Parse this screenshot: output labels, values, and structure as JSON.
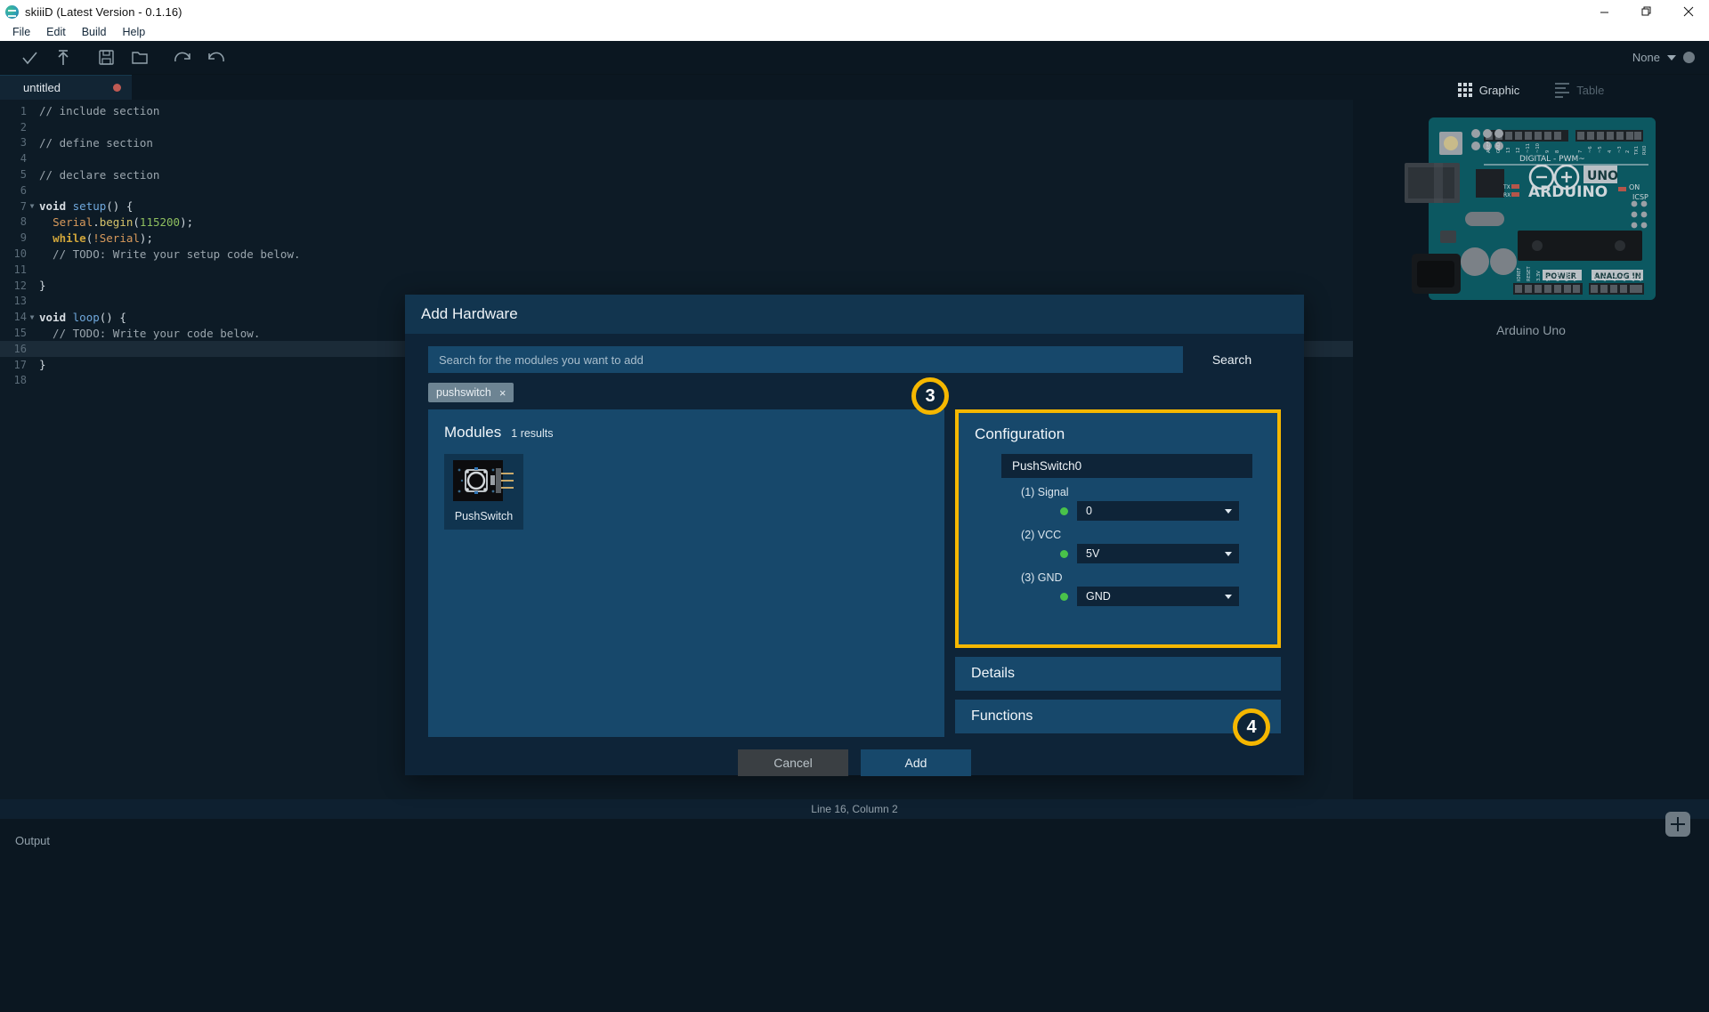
{
  "window": {
    "title": "skiiiD (Latest Version - 0.1.16)",
    "minimize_label": "minimize",
    "maximize_label": "maximize",
    "close_label": "close"
  },
  "menubar": {
    "items": [
      "File",
      "Edit",
      "Build",
      "Help"
    ]
  },
  "toolbar": {
    "icons": [
      "check-icon",
      "upload-icon",
      "save-icon",
      "open-folder-icon",
      "redo-icon",
      "undo-icon"
    ],
    "board_selector_value": "None"
  },
  "editor": {
    "tab": {
      "label": "untitled",
      "dirty": true
    },
    "current_line_number": 16,
    "lines": [
      {
        "n": 1,
        "tokens": [
          {
            "t": "// include section",
            "c": "c-comment"
          }
        ]
      },
      {
        "n": 2,
        "tokens": []
      },
      {
        "n": 3,
        "tokens": [
          {
            "t": "// define section",
            "c": "c-comment"
          }
        ]
      },
      {
        "n": 4,
        "tokens": []
      },
      {
        "n": 5,
        "tokens": [
          {
            "t": "// declare section",
            "c": "c-comment"
          }
        ]
      },
      {
        "n": 6,
        "tokens": []
      },
      {
        "n": 7,
        "fold": true,
        "tokens": [
          {
            "t": "void ",
            "c": "c-kw"
          },
          {
            "t": "setup",
            "c": "c-fn"
          },
          {
            "t": "() {",
            "c": "c-plain"
          }
        ]
      },
      {
        "n": 8,
        "tokens": [
          {
            "t": "  ",
            "c": "c-plain"
          },
          {
            "t": "Serial",
            "c": "c-obj"
          },
          {
            "t": ".",
            "c": "c-plain"
          },
          {
            "t": "begin",
            "c": "c-meth"
          },
          {
            "t": "(",
            "c": "c-plain"
          },
          {
            "t": "115200",
            "c": "c-num"
          },
          {
            "t": ");",
            "c": "c-plain"
          }
        ]
      },
      {
        "n": 9,
        "tokens": [
          {
            "t": "  ",
            "c": "c-plain"
          },
          {
            "t": "while",
            "c": "c-ctl"
          },
          {
            "t": "(",
            "c": "c-plain"
          },
          {
            "t": "!Serial",
            "c": "c-obj"
          },
          {
            "t": ");",
            "c": "c-plain"
          }
        ]
      },
      {
        "n": 10,
        "tokens": [
          {
            "t": "  // TODO: Write your setup code below.",
            "c": "c-comment"
          }
        ]
      },
      {
        "n": 11,
        "tokens": []
      },
      {
        "n": 12,
        "tokens": [
          {
            "t": "}",
            "c": "c-plain"
          }
        ]
      },
      {
        "n": 13,
        "tokens": []
      },
      {
        "n": 14,
        "fold": true,
        "tokens": [
          {
            "t": "void ",
            "c": "c-kw"
          },
          {
            "t": "loop",
            "c": "c-fn"
          },
          {
            "t": "() {",
            "c": "c-plain"
          }
        ]
      },
      {
        "n": 15,
        "tokens": [
          {
            "t": "  // TODO: Write your code below.",
            "c": "c-comment"
          }
        ]
      },
      {
        "n": 16,
        "tokens": []
      },
      {
        "n": 17,
        "tokens": [
          {
            "t": "}",
            "c": "c-plain"
          }
        ]
      },
      {
        "n": 18,
        "tokens": []
      }
    ]
  },
  "right_panel": {
    "tabs": [
      {
        "label": "Graphic",
        "icon": "grid-icon",
        "active": true
      },
      {
        "label": "Table",
        "icon": "list-lines-icon",
        "active": false
      }
    ],
    "board_caption": "Arduino Uno",
    "board_silkscreen": {
      "brand": "ARDUINO",
      "model": "UNO",
      "digital_header": "DIGITAL - PWM~",
      "power_header": "POWER",
      "analog_header": "ANALOG IN",
      "on_led": "ON",
      "icsp": "ICSP",
      "tx_led": "TX",
      "rx_led": "RX",
      "digital_pins": [
        "AREF",
        "GND",
        "13",
        "12",
        "~11",
        "~10",
        "9",
        "8",
        "7",
        "~6",
        "~5",
        "4",
        "~3",
        "2",
        "TX→1",
        "RX←0"
      ],
      "power_pins": [
        "IOREF",
        "RESET",
        "3.3V",
        "5V",
        "GND",
        "GND",
        "Vin"
      ],
      "analog_pins": [
        "A0",
        "A1",
        "A2",
        "A3",
        "A4",
        "A5"
      ]
    }
  },
  "statusbar": {
    "text": "Line 16, Column 2"
  },
  "output": {
    "label": "Output"
  },
  "fab": {
    "label": "+",
    "icon": "plus-icon"
  },
  "modal": {
    "title": "Add Hardware",
    "search": {
      "placeholder": "Search for the modules you want to add",
      "value": "",
      "button_label": "Search"
    },
    "chips": [
      {
        "label": "pushswitch",
        "remove": "×"
      }
    ],
    "modules": {
      "title": "Modules",
      "count_label": "1 results",
      "cards": [
        {
          "name": "PushSwitch",
          "icon": "pushswitch-module-image"
        }
      ]
    },
    "configuration": {
      "title": "Configuration",
      "instance_name": "PushSwitch0",
      "pins": [
        {
          "label": "(1) Signal",
          "value": "0",
          "status": "connected"
        },
        {
          "label": "(2) VCC",
          "value": "5V",
          "status": "connected"
        },
        {
          "label": "(3) GND",
          "value": "GND",
          "status": "connected"
        }
      ]
    },
    "accordions": [
      {
        "label": "Details"
      },
      {
        "label": "Functions"
      }
    ],
    "footer": {
      "cancel_label": "Cancel",
      "add_label": "Add"
    }
  },
  "callouts": [
    {
      "number": "3"
    },
    {
      "number": "4"
    }
  ],
  "colors": {
    "accent_yellow": "#f5b700",
    "modal_bg": "#0e2438",
    "panel_blue": "#17486b",
    "editor_bg": "#0d1b26",
    "pin_ok_green": "#49c24a",
    "dirty_dot_red": "#bf5a53"
  }
}
